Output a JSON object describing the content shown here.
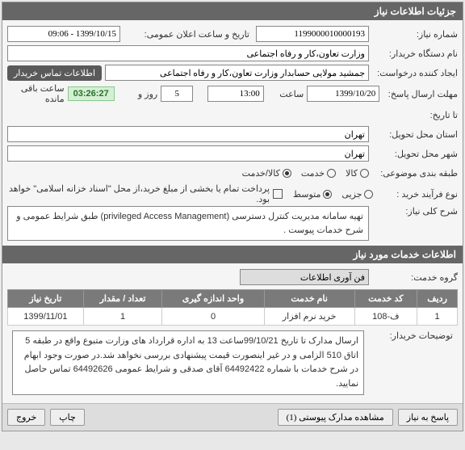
{
  "header": {
    "title": "جزئیات اطلاعات نیاز"
  },
  "form": {
    "need_number": {
      "label": "شماره نیاز:",
      "value": "1199000010000193"
    },
    "announce_date": {
      "label": "تاریخ و ساعت اعلان عمومی:",
      "value": "1399/10/15 - 09:06"
    },
    "org_name": {
      "label": "نام دستگاه خریدار:",
      "value": "وزارت تعاون،کار و رفاه اجتماعی"
    },
    "creator": {
      "label": "ایجاد کننده درخواست:",
      "value": "جمشید مولایی حسابدار وزارت تعاون،کار و رفاه اجتماعی"
    },
    "contact_btn": "اطلاعات تماس خریدار",
    "deadline": {
      "label": "مهلت ارسال پاسخ:",
      "value": "1399/10/20"
    },
    "to_date": {
      "label": "تا تاریخ:"
    },
    "hour_label": "ساعت",
    "hour_value": "13:00",
    "days_value": "5",
    "days_label": "روز و",
    "countdown": "03:26:27",
    "remaining_label": "ساعت باقی مانده",
    "delivery_province": {
      "label": "استان محل تحویل:",
      "value": "تهران"
    },
    "delivery_city": {
      "label": "شهر محل تحویل:",
      "value": "تهران"
    },
    "item_type": {
      "label": "طبقه بندی موضوعی:",
      "opts": [
        {
          "label": "کالا",
          "checked": false
        },
        {
          "label": "خدمت",
          "checked": false
        },
        {
          "label": "کالا/خدمت",
          "checked": true
        }
      ]
    },
    "purchase_type": {
      "label": "نوع فرآیند خرید :",
      "opts": [
        {
          "label": "جزیی",
          "checked": false
        },
        {
          "label": "متوسط",
          "checked": true
        }
      ],
      "note_chk": "پرداخت تمام یا بخشی از مبلغ خرید،از محل \"اسناد خزانه اسلامی\" خواهد بود."
    },
    "general_desc": {
      "label": "شرح کلی نیاز:",
      "value": "تهیه سامانه مدیریت کنترل دسترسی (privileged Access Management) طبق شرایط عمومی و شرح خدمات پیوست ."
    }
  },
  "services_header": "اطلاعات خدمات مورد نیاز",
  "service_group": {
    "label": "گروه خدمت:",
    "value": "فن آوری اطلاعات"
  },
  "table": {
    "headers": [
      "ردیف",
      "کد خدمت",
      "نام خدمت",
      "واحد اندازه گیری",
      "تعداد / مقدار",
      "تاریخ نیاز"
    ],
    "rows": [
      [
        "1",
        "ف-108",
        "خرید نرم افزار",
        "0",
        "1",
        "1399/11/01"
      ]
    ]
  },
  "buyer_notes": {
    "label": "توضیحات خریدار:",
    "value": "ارسال مدارک تا تاریخ 99/10/21ساعت 13 به اداره قرارداد های وزارت متبوع واقع در طبقه 5 اتاق 510 الزامی و در غیر اینصورت قیمت پیشنهادی بررسی نخواهد شد.در صورت وجود ابهام در شرح خدمات با شماره 64492422 آقای صدقی و شرایط عمومی 64492626 تماس حاصل نمایید."
  },
  "buttons": {
    "respond": "پاسخ به نیاز",
    "attachments": "مشاهده مدارک پیوستی (1)",
    "print": "چاپ",
    "exit": "خروج"
  }
}
